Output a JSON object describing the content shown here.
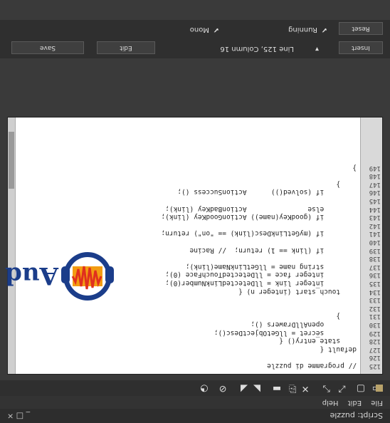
{
  "window": {
    "title": "Script: puzzle",
    "controls": "_ □ ×"
  },
  "menu": {
    "items": [
      "File",
      "Edit",
      "Help"
    ]
  },
  "toolbar": {
    "icons": [
      "save-icon",
      "save-all-icon",
      "open-icon",
      "cut-icon",
      "copy-icon",
      "paste-icon",
      "undo-icon",
      "redo-icon",
      "search-icon",
      "compile-icon"
    ]
  },
  "code": {
    "line_numbers": [
      "125",
      "126",
      "127",
      "128",
      "129",
      "130",
      "131",
      "132",
      "133",
      "134",
      "135",
      "136",
      "137",
      "138",
      "139",
      "140",
      "141",
      "142",
      "143",
      "144",
      "145",
      "146",
      "147",
      "148",
      "149"
    ],
    "lines": [
      "// programme di puzzle",
      "",
      "default {",
      "    state_entry() {",
      "        secret = llGetObjectDesc();",
      "        openAllDrawers ();",
      "    }",
      "",
      "",
      "    touch_start (integer n) {",
      "        integer link = llDetectedLinkNumber(0);",
      "        integer face = llDetectedTouchFace (0);",
      "        string name = llGetLinkName(link);",
      "",
      "        if (link == 1) return;  // Racine",
      "",
      "        if (myGetLinkDesc(link) == \"on\") return;",
      "",
      "        if (goodKey(name)) ActionGoodKey (link);",
      "        else               ActionBadKey (link);",
      "",
      "        if (solved())      ActionSuccess ();",
      "    }",
      "",
      "}"
    ]
  },
  "logo": {
    "text": "Aud"
  },
  "controls": {
    "insert_label": "Insert",
    "position_label": "Line 125, Column 16",
    "edit_label": "Edit",
    "save_label": "Save",
    "reset_label": "Reset",
    "running_label": "Running",
    "mono_label": "Mono"
  },
  "colors": {
    "accent": "#b8a26a",
    "keyword": "#1a3fa6"
  }
}
